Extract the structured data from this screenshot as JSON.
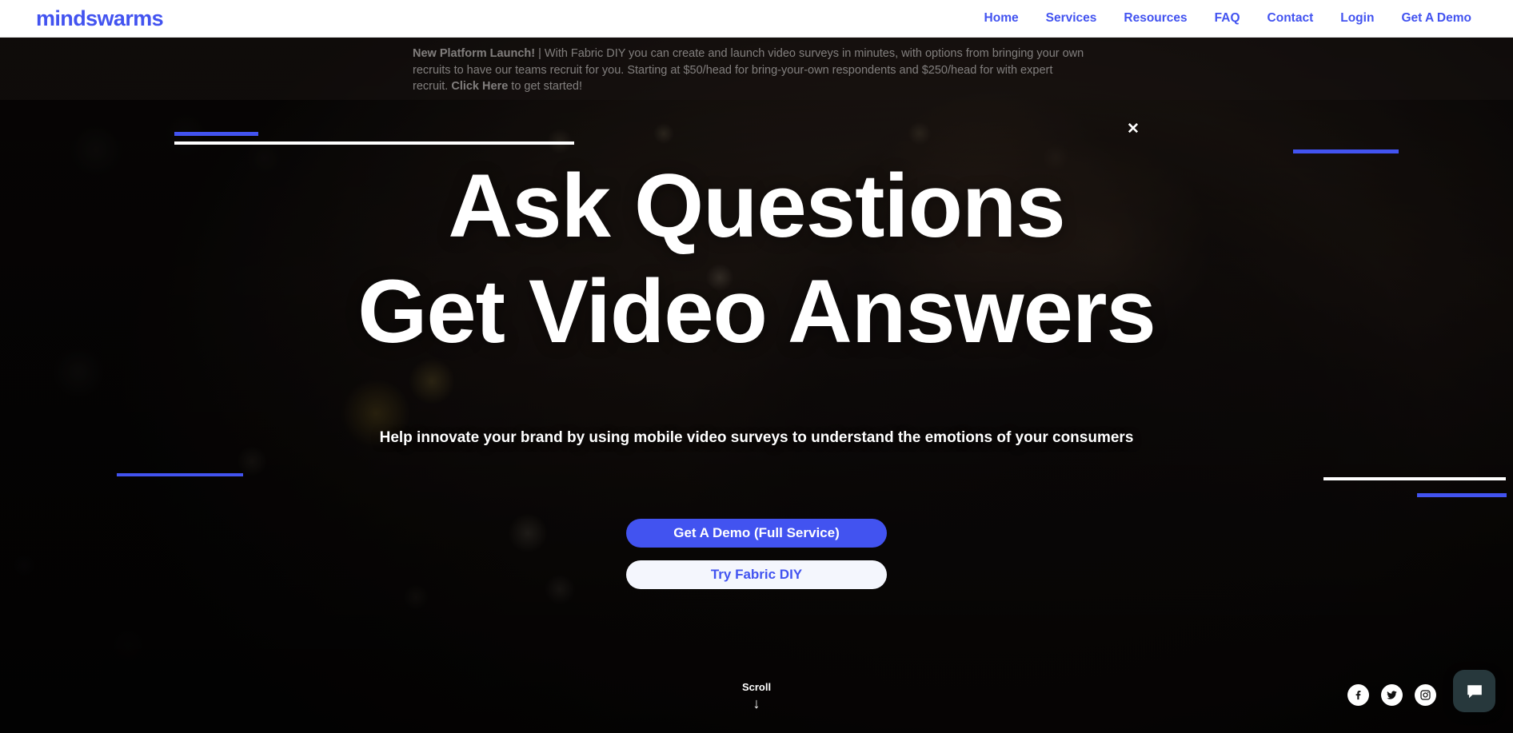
{
  "brand": {
    "logo_text": "mindswarms",
    "accent_color": "#4253f0"
  },
  "nav": {
    "items": [
      {
        "label": "Home"
      },
      {
        "label": "Services"
      },
      {
        "label": "Resources"
      },
      {
        "label": "FAQ"
      },
      {
        "label": "Contact"
      },
      {
        "label": "Login"
      },
      {
        "label": "Get A Demo"
      }
    ]
  },
  "banner": {
    "lead": "New Platform Launch!",
    "separator": " | ",
    "body_1": "With Fabric DIY you can create and launch video surveys in minutes, with options from bringing your own recruits to have our teams recruit for you. Starting at $50/head for bring-your-own respondents and $250/head for with expert recruit. ",
    "link": "Click Here",
    "body_2": " to get started!",
    "close_label": "✕"
  },
  "hero": {
    "headline_line1": "Ask Questions",
    "headline_line2": "Get Video Answers",
    "subheadline": "Help innovate your brand by using mobile video surveys to understand the emotions of your consumers",
    "primary_button": "Get A Demo (Full Service)",
    "secondary_button": "Try Fabric DIY",
    "scroll_label": "Scroll",
    "scroll_arrow": "↓"
  },
  "social": {
    "items": [
      {
        "name": "facebook"
      },
      {
        "name": "twitter"
      },
      {
        "name": "instagram"
      }
    ]
  },
  "chat": {
    "name": "chat-widget"
  }
}
